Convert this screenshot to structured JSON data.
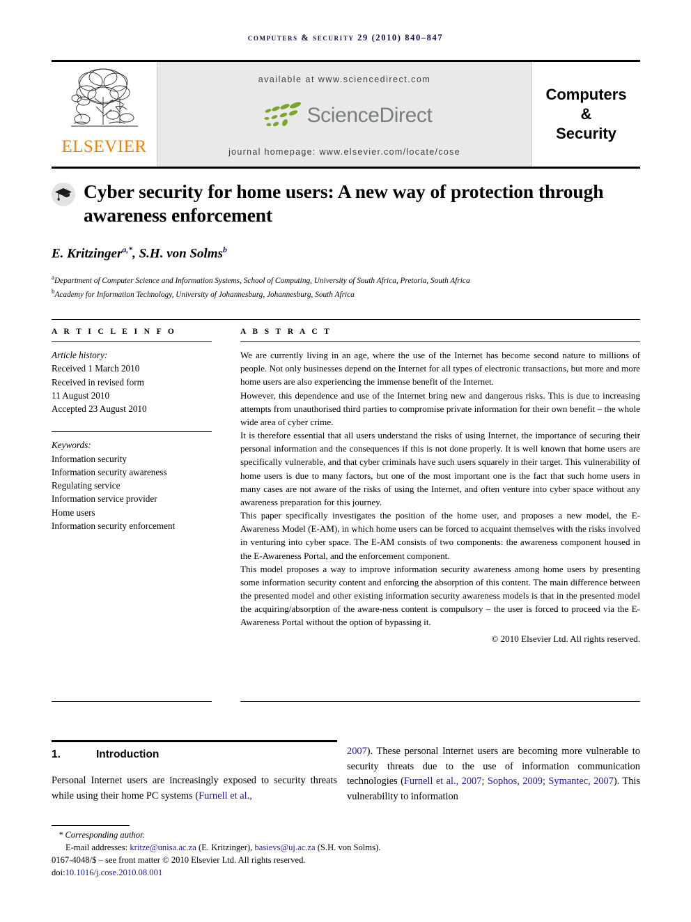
{
  "running_head": "Computers & Security 29 (2010) 840–847",
  "masthead": {
    "publisher_logo_name": "elsevier-tree-logo",
    "publisher_wordmark": "ELSEVIER",
    "available_at": "available at www.sciencedirect.com",
    "sciencedirect_wordmark": "ScienceDirect",
    "journal_homepage": "journal homepage: www.elsevier.com/locate/cose",
    "journal_title_lines": [
      "Computers",
      "&",
      "Security"
    ],
    "colors": {
      "elsevier_orange": "#f08000",
      "sciencedirect_green": "#7aa526",
      "sciencedirect_gray": "#787f78",
      "banner_background": "#e9e9e9",
      "running_head_navy": "#10104a"
    }
  },
  "article": {
    "crossmark_icon": "graduation-cap-icon",
    "title": "Cyber security for home users: A new way of protection through awareness enforcement",
    "authors_html": "E. Kritzinger<sup>a,*</sup>, S.H. von Solms<sup>b</sup>",
    "affiliations": [
      {
        "marker": "a",
        "text": "Department of Computer Science and Information Systems, School of Computing, University of South Africa, Pretoria, South Africa"
      },
      {
        "marker": "b",
        "text": "Academy for Information Technology, University of Johannesburg, Johannesburg, South Africa"
      }
    ]
  },
  "article_info": {
    "heading": "A R T I C L E   I N F O",
    "history_label": "Article history:",
    "history": [
      "Received 1 March 2010",
      "Received in revised form",
      "11 August 2010",
      "Accepted 23 August 2010"
    ],
    "keywords_label": "Keywords:",
    "keywords": [
      "Information security",
      "Information security awareness",
      "Regulating service",
      "Information service provider",
      "Home users",
      "Information security enforcement"
    ]
  },
  "abstract": {
    "heading": "A B S T R A C T",
    "paragraphs": [
      "We are currently living in an age, where the use of the Internet has become second nature to millions of people. Not only businesses depend on the Internet for all types of electronic transactions, but more and more home users are also experiencing the immense benefit of the Internet.",
      "However, this dependence and use of the Internet bring new and dangerous risks. This is due to increasing attempts from unauthorised third parties to compromise private information for their own benefit – the whole wide area of cyber crime.",
      "It is therefore essential that all users understand the risks of using Internet, the importance of securing their personal information and the consequences if this is not done properly. It is well known that home users are specifically vulnerable, and that cyber criminals have such users squarely in their target. This vulnerability of home users is due to many factors, but one of the most important one is the fact that such home users in many cases are not aware of the risks of using the Internet, and often venture into cyber space without any awareness preparation for this journey.",
      "This paper specifically investigates the position of the home user, and proposes a new model, the E-Awareness Model (E-AM), in which home users can be forced to acquaint themselves with the risks involved in venturing into cyber space. The E-AM consists of two components: the awareness component housed in the E-Awareness Portal, and the enforcement component.",
      "This model proposes a way to improve information security awareness among home users by presenting some information security content and enforcing the absorption of this content. The main difference between the presented model and other existing information security awareness models is that in the presented model the acquiring/absorption of the aware-ness content is compulsory – the user is forced to proceed via the E-Awareness Portal without the option of bypassing it."
    ],
    "copyright": "© 2010 Elsevier Ltd. All rights reserved."
  },
  "introduction": {
    "number": "1.",
    "title": "Introduction",
    "left_column_text": "Personal Internet users are increasingly exposed to security threats while using their home PC systems (",
    "left_column_citation": "Furnell et al.,",
    "right_column_citation_lead": "2007",
    "right_column_text_1": "). These personal Internet users are becoming more vulnerable to security threats due to the use of information communication technologies (",
    "right_column_citation_2": "Furnell et al., 2007; Sophos, 2009; Symantec, 2007",
    "right_column_text_2": "). This vulnerability to information"
  },
  "footer": {
    "corresponding_author": "* Corresponding author.",
    "email_label": "E-mail addresses:",
    "email_1": "kritze@unisa.ac.za",
    "email_1_owner": "(E. Kritzinger),",
    "email_2": "basievs@uj.ac.za",
    "email_2_owner": "(S.H. von Solms).",
    "issn_line": "0167-4048/$ – see front matter © 2010 Elsevier Ltd. All rights reserved.",
    "doi_label": "doi:",
    "doi_value": "10.1016/j.cose.2010.08.001"
  }
}
